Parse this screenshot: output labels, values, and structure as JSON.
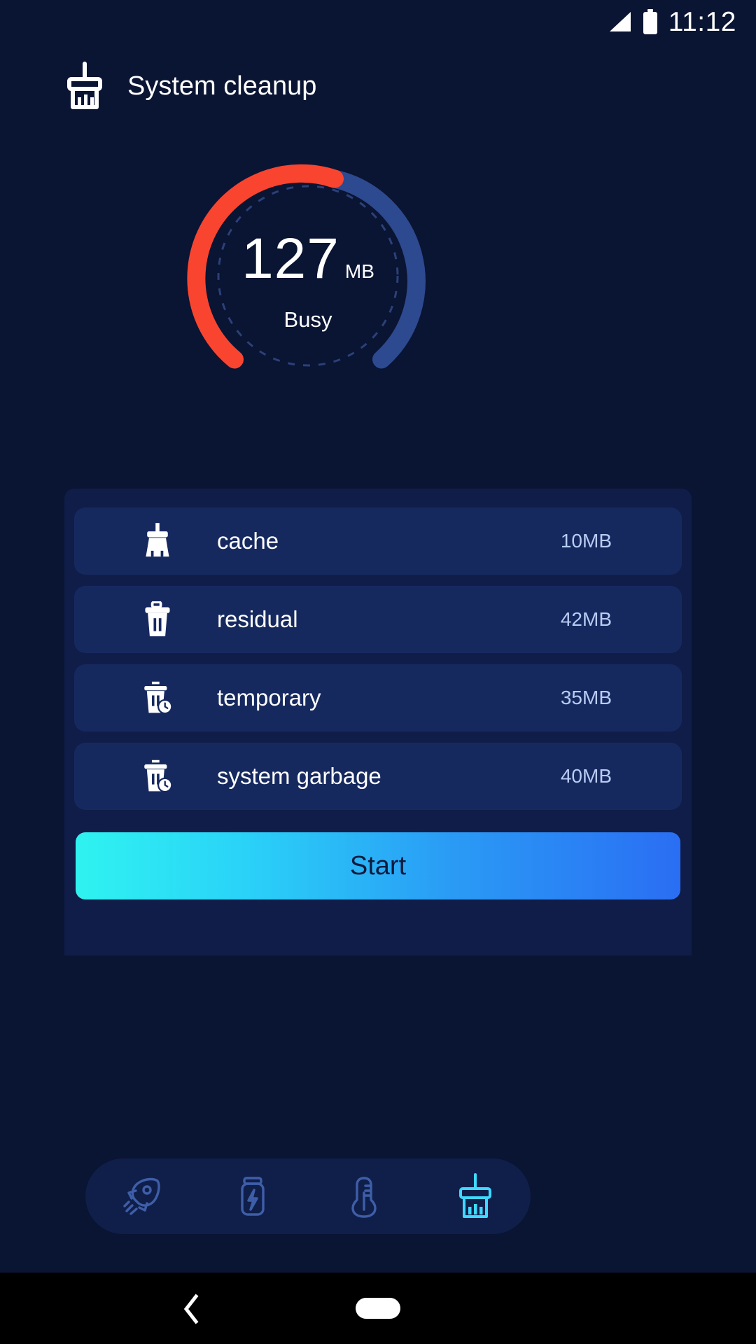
{
  "status_bar": {
    "clock": "11:12",
    "signal_icon": "signal-triangle-icon",
    "battery_icon": "battery-full-icon"
  },
  "header": {
    "title": "System cleanup",
    "icon": "broom-icon"
  },
  "gauge": {
    "value": "127",
    "unit": "MB",
    "status": "Busy",
    "used_color": "#f9452f",
    "track_color": "#2d498f",
    "dashed_ring_color": "#2a3d73",
    "used_percent": 62,
    "sweep_start_deg": 215,
    "sweep_total_deg": 290
  },
  "list": {
    "items": [
      {
        "icon": "broom-icon",
        "label": "cache",
        "size": "10MB"
      },
      {
        "icon": "trash-icon",
        "label": "residual",
        "size": "42MB"
      },
      {
        "icon": "trash-clock-icon",
        "label": "temporary",
        "size": "35MB"
      },
      {
        "icon": "trash-clock-icon",
        "label": "system garbage",
        "size": "40MB"
      }
    ]
  },
  "start_button": {
    "label": "Start",
    "gradient_from": "#2ff3f0",
    "gradient_to": "#2a6ef3",
    "text_color": "#0d1b3d"
  },
  "bottom_nav": {
    "items": [
      {
        "icon": "rocket-icon",
        "active": false
      },
      {
        "icon": "battery-bolt-icon",
        "active": false
      },
      {
        "icon": "thermometer-icon",
        "active": false
      },
      {
        "icon": "broom-icon",
        "active": true
      }
    ],
    "inactive_color": "#3f5ea8",
    "active_color": "#3fd8ff"
  },
  "android_nav": {
    "back_icon": "back-chevron-icon",
    "home_icon": "home-pill-icon"
  },
  "theme": {
    "background": "#0a1433",
    "card_background": "#0f1d48",
    "row_background": "#16295f"
  }
}
